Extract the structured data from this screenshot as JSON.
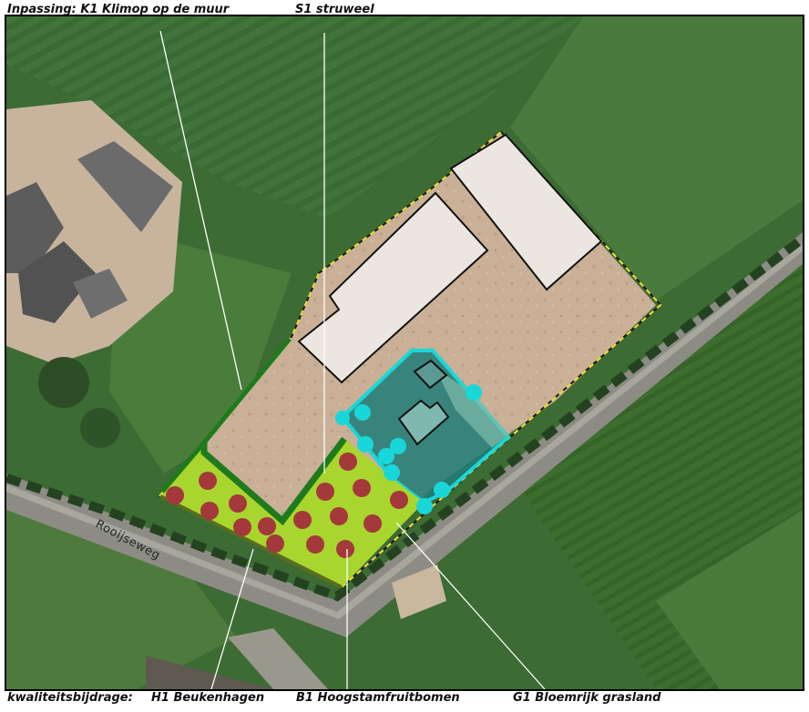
{
  "header": {
    "inpassing": "Inpassing: K1 Klimop op de muur",
    "struweel": "S1 struweel"
  },
  "footer": {
    "kwaliteitsbijdrage": "kwaliteitsbijdrage:",
    "beukenhagen": "H1 Beukenhagen",
    "hoogstam": "B1 Hoogstamfruitbomen",
    "grasland": "G1 Bloemrijk grasland"
  },
  "map": {
    "street_name": "Rooijseweg"
  },
  "colors": {
    "meadow": "#3f6e34",
    "field_dark": "#2f5a28",
    "yard": "#cdb59c",
    "building": "#ece6e1",
    "grassland": "#a9d62e",
    "hedge": "#1f7a1c",
    "fruit_tree": "#a3393a",
    "cyan_outline": "#19d7d9",
    "plot_boundary": "#f5e03a"
  },
  "icons": {
    "fruit_tree": "red-circle",
    "struweel": "cyan-circle"
  }
}
